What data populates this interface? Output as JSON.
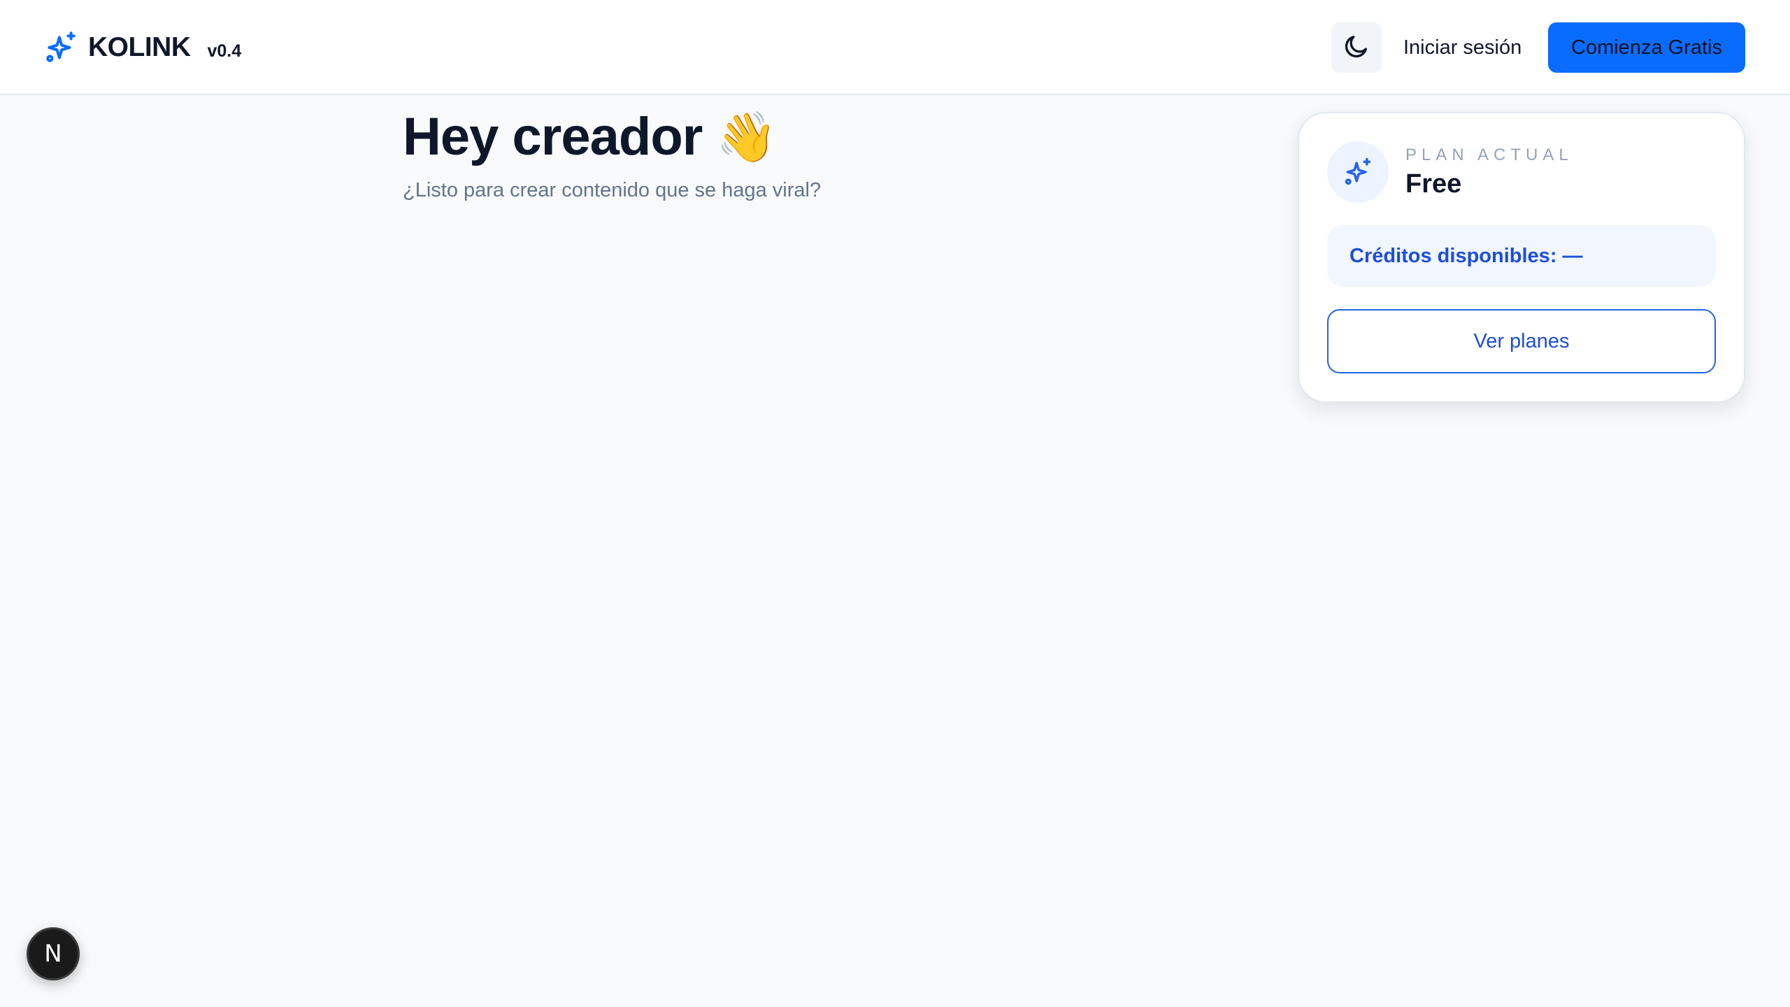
{
  "header": {
    "logo_name": "KOLINK",
    "logo_version": "v0.4",
    "theme_toggle_icon": "moon-icon",
    "login_label": "Iniciar sesión",
    "cta_label": "Comienza Gratis"
  },
  "hero": {
    "title": "Hey creador",
    "title_emoji": "👋",
    "subtitle": "¿Listo para crear contenido que se haga viral?"
  },
  "plan_card": {
    "icon": "sparkles-icon",
    "label": "PLAN ACTUAL",
    "plan_name": "Free",
    "credits_text": "Créditos disponibles: —",
    "button_label": "Ver planes"
  },
  "dev_badge": {
    "letter": "N"
  },
  "colors": {
    "accent": "#0a6cff",
    "credits_text": "#1d4ed8",
    "background": "#f8fafc"
  }
}
